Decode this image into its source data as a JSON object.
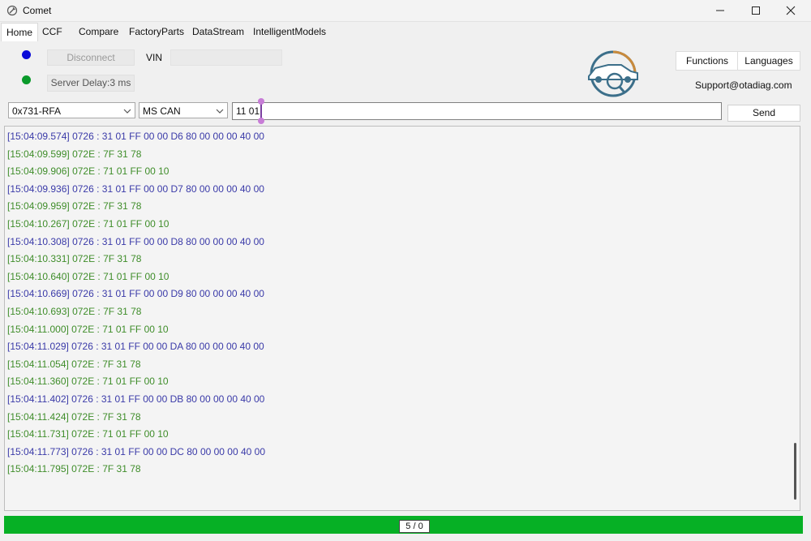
{
  "window": {
    "title": "Comet",
    "icon": "comet-wrench-icon"
  },
  "tabs": [
    {
      "label": "Home",
      "active": true
    },
    {
      "label": "CCF"
    },
    {
      "label": "Compare"
    },
    {
      "label": "FactoryParts"
    },
    {
      "label": "DataStream"
    },
    {
      "label": "IntelligentModels"
    }
  ],
  "connection": {
    "disconnect_label": "Disconnect",
    "vin_label": "VIN",
    "vin_value": "",
    "server_delay": "Server Delay:3 ms",
    "status_colors": {
      "link": "#0a0ad8",
      "server": "#0a9a2a"
    }
  },
  "right_panel": {
    "functions_label": "Functions",
    "languages_label": "Languages",
    "support_email": "Support@otadiag.com"
  },
  "command_bar": {
    "module": "0x731-RFA",
    "protocol": "MS CAN",
    "command": "11 01",
    "send_label": "Send"
  },
  "log": [
    {
      "text": "[15:04:09.574] 0726 : 31 01 FF 00 00 D6 80 00 00 00 40 00",
      "dir": "tx"
    },
    {
      "text": "[15:04:09.599] 072E : 7F 31 78",
      "dir": "rx"
    },
    {
      "text": "[15:04:09.906] 072E : 71 01 FF 00 10",
      "dir": "rx"
    },
    {
      "text": "[15:04:09.936] 0726 : 31 01 FF 00 00 D7 80 00 00 00 40 00",
      "dir": "tx"
    },
    {
      "text": "[15:04:09.959] 072E : 7F 31 78",
      "dir": "rx"
    },
    {
      "text": "[15:04:10.267] 072E : 71 01 FF 00 10",
      "dir": "rx"
    },
    {
      "text": "[15:04:10.308] 0726 : 31 01 FF 00 00 D8 80 00 00 00 40 00",
      "dir": "tx"
    },
    {
      "text": "[15:04:10.331] 072E : 7F 31 78",
      "dir": "rx"
    },
    {
      "text": "[15:04:10.640] 072E : 71 01 FF 00 10",
      "dir": "rx"
    },
    {
      "text": "[15:04:10.669] 0726 : 31 01 FF 00 00 D9 80 00 00 00 40 00",
      "dir": "tx"
    },
    {
      "text": "[15:04:10.693] 072E : 7F 31 78",
      "dir": "rx"
    },
    {
      "text": "[15:04:11.000] 072E : 71 01 FF 00 10",
      "dir": "rx"
    },
    {
      "text": "[15:04:11.029] 0726 : 31 01 FF 00 00 DA 80 00 00 00 40 00",
      "dir": "tx"
    },
    {
      "text": "[15:04:11.054] 072E : 7F 31 78",
      "dir": "rx"
    },
    {
      "text": "[15:04:11.360] 072E : 71 01 FF 00 10",
      "dir": "rx"
    },
    {
      "text": "[15:04:11.402] 0726 : 31 01 FF 00 00 DB 80 00 00 00 40 00",
      "dir": "tx"
    },
    {
      "text": "[15:04:11.424] 072E : 7F 31 78",
      "dir": "rx"
    },
    {
      "text": "[15:04:11.731] 072E : 71 01 FF 00 10",
      "dir": "rx"
    },
    {
      "text": "[15:04:11.773] 0726 : 31 01 FF 00 00 DC 80 00 00 00 40 00",
      "dir": "tx"
    },
    {
      "text": "[15:04:11.795] 072E : 7F 31 78",
      "dir": "rx"
    }
  ],
  "status": {
    "count": "5 / 0",
    "bar_color": "#06b025"
  }
}
